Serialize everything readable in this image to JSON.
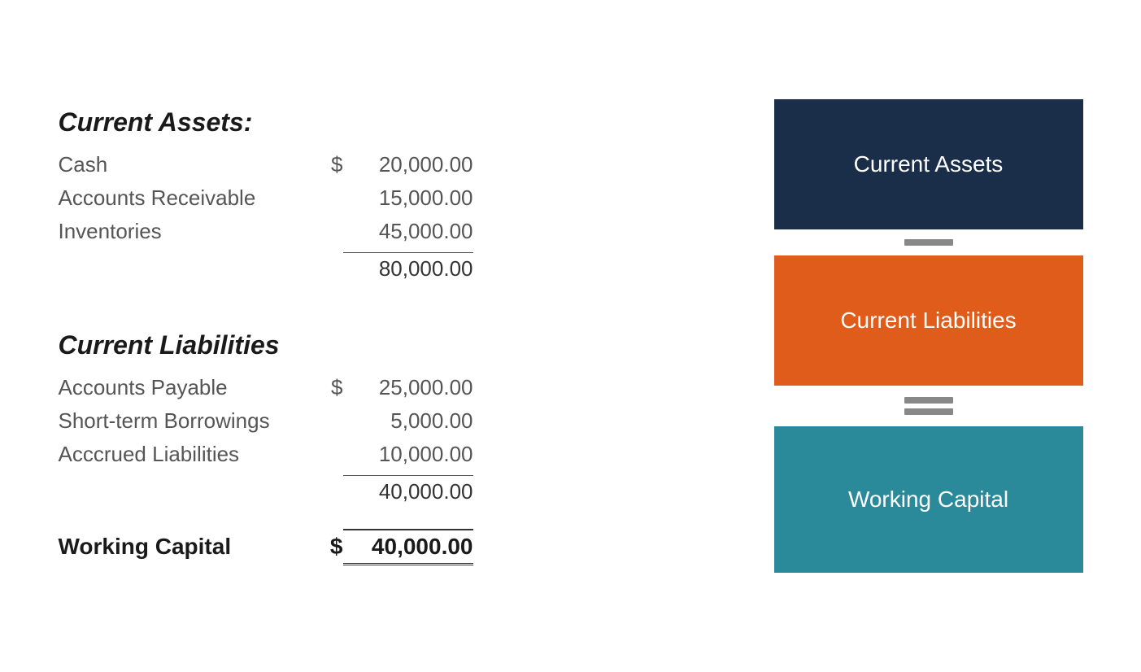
{
  "currentAssets": {
    "header": "Current Assets:",
    "items": [
      {
        "label": "Cash",
        "currency": "$",
        "value": "20,000.00"
      },
      {
        "label": "Accounts Receivable",
        "currency": "",
        "value": "15,000.00"
      },
      {
        "label": "Inventories",
        "currency": "",
        "value": "45,000.00"
      }
    ],
    "subtotal": "80,000.00"
  },
  "currentLiabilities": {
    "header": "Current Liabilities",
    "items": [
      {
        "label": "Accounts Payable",
        "currency": "$",
        "value": "25,000.00"
      },
      {
        "label": "Short-term Borrowings",
        "currency": "",
        "value": "5,000.00"
      },
      {
        "label": "Acccrued Liabilities",
        "currency": "",
        "value": "10,000.00"
      }
    ],
    "subtotal": "40,000.00"
  },
  "workingCapital": {
    "label": "Working Capital",
    "currency": "$",
    "value": "40,000.00"
  },
  "visual": {
    "currentAssetsLabel": "Current Assets",
    "currentLiabilitiesLabel": "Current Liabilities",
    "workingCapitalLabel": "Working Capital"
  }
}
